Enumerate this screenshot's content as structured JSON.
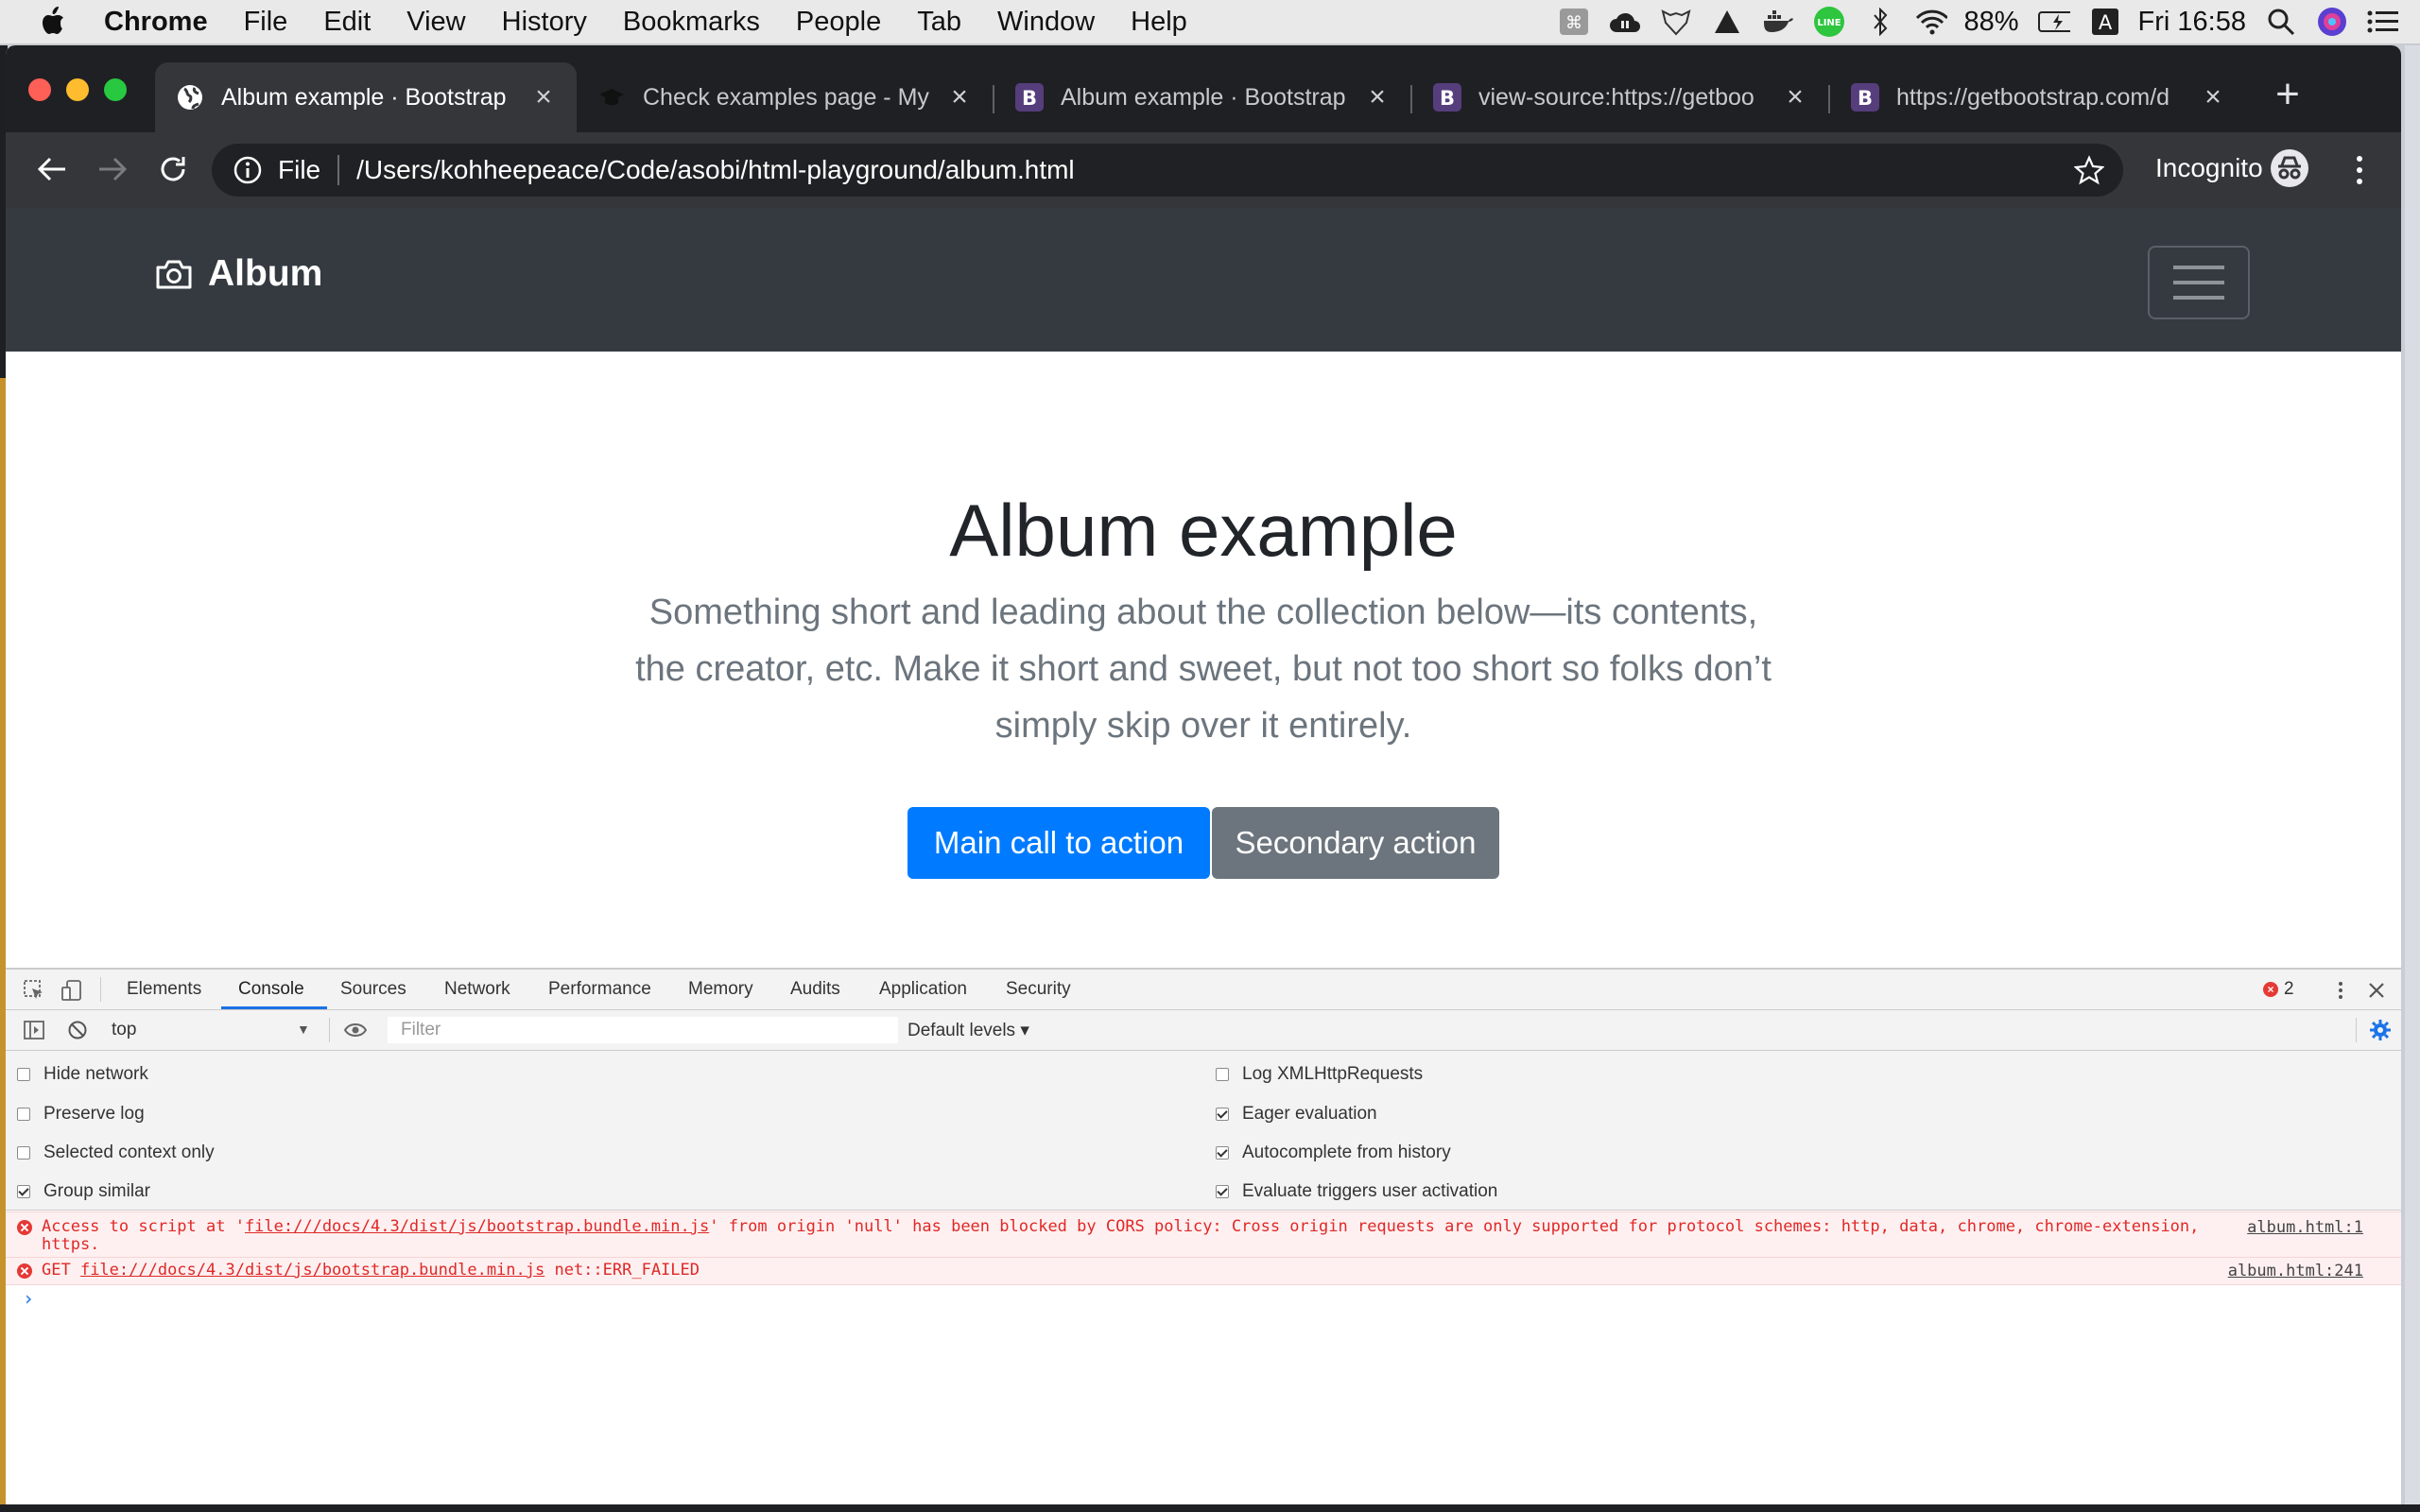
{
  "menubar": {
    "app": "Chrome",
    "items": [
      "File",
      "Edit",
      "View",
      "History",
      "Bookmarks",
      "People",
      "Tab",
      "Window",
      "Help"
    ],
    "battery": "88%",
    "clock": "Fri 16:58"
  },
  "tabs": [
    {
      "title": "Album example · Bootstrap",
      "active": true
    },
    {
      "title": "Check examples page - My",
      "active": false
    },
    {
      "title": "Album example · Bootstrap",
      "active": false
    },
    {
      "title": "view-source:https://getboo",
      "active": false
    },
    {
      "title": "https://getbootstrap.com/d",
      "active": false
    }
  ],
  "omnibox": {
    "scheme_label": "File",
    "url": "/Users/kohheepeace/Code/asobi/html-playground/album.html"
  },
  "profile": {
    "label": "Incognito"
  },
  "site": {
    "brand": "Album",
    "heading": "Album example",
    "lead": "Something short and leading about the collection below—its contents, the creator, etc. Make it short and sweet, but not too short so folks don’t simply skip over it entirely.",
    "primary_btn": "Main call to action",
    "secondary_btn": "Secondary action"
  },
  "devtools": {
    "tabs": [
      "Elements",
      "Console",
      "Sources",
      "Network",
      "Performance",
      "Memory",
      "Audits",
      "Application",
      "Security"
    ],
    "active_tab": "Console",
    "error_count": "2",
    "context": "top",
    "filter_placeholder": "Filter",
    "levels": "Default levels ▾",
    "settings_left": [
      {
        "label": "Hide network",
        "checked": false
      },
      {
        "label": "Preserve log",
        "checked": false
      },
      {
        "label": "Selected context only",
        "checked": false
      },
      {
        "label": "Group similar",
        "checked": true
      }
    ],
    "settings_right": [
      {
        "label": "Log XMLHttpRequests",
        "checked": false
      },
      {
        "label": "Eager evaluation",
        "checked": true
      },
      {
        "label": "Autocomplete from history",
        "checked": true
      },
      {
        "label": "Evaluate triggers user activation",
        "checked": true
      }
    ],
    "messages": [
      {
        "prefix": "Access to script at '",
        "link": "file:///docs/4.3/dist/js/bootstrap.bundle.min.js",
        "suffix": "' from origin 'null' has been blocked by CORS policy: Cross origin requests are only supported for protocol schemes: http, data, chrome, chrome-extension, https.",
        "source": "album.html:1"
      },
      {
        "prefix": "GET ",
        "link": "file:///docs/4.3/dist/js/bootstrap.bundle.min.js",
        "suffix": " net::ERR_FAILED",
        "source": "album.html:241"
      }
    ],
    "prompt": "›"
  }
}
